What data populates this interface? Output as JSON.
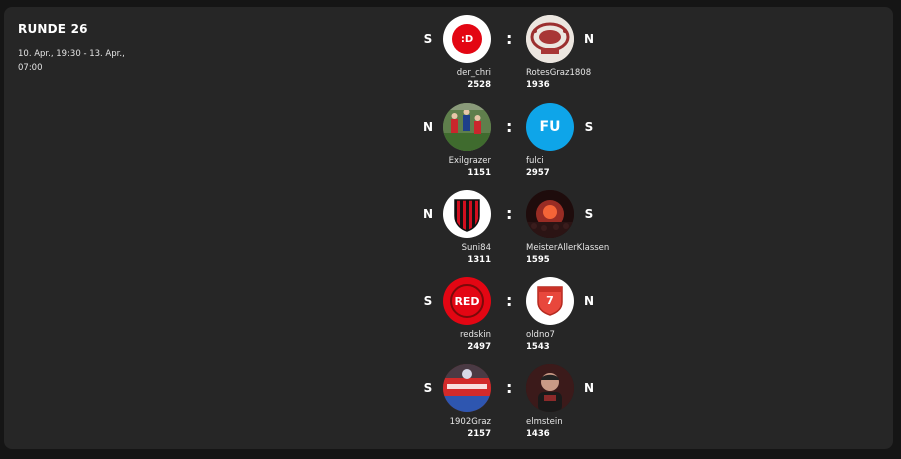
{
  "round": {
    "title": "RUNDE 26",
    "date": "10. Apr., 19:30 - 13. Apr., 07:00"
  },
  "separator": ":",
  "matches": [
    {
      "left": {
        "result": "S",
        "name": "der_chri",
        "score": "2528",
        "avatar": "red-emoticon-logo",
        "avatar_text": ":D"
      },
      "right": {
        "result": "N",
        "name": "RotesGraz1808",
        "score": "1936",
        "avatar": "club-crest-photo"
      }
    },
    {
      "left": {
        "result": "N",
        "name": "Exilgrazer",
        "score": "1151",
        "avatar": "football-players-photo"
      },
      "right": {
        "result": "S",
        "name": "fulci",
        "score": "2957",
        "avatar": "blue-initials-avatar",
        "avatar_text": "FU"
      }
    },
    {
      "left": {
        "result": "N",
        "name": "Suni84",
        "score": "1311",
        "avatar": "striped-shield-crest"
      },
      "right": {
        "result": "S",
        "name": "MeisterAllerKlassen",
        "score": "1595",
        "avatar": "flare-crowd-photo"
      }
    },
    {
      "left": {
        "result": "S",
        "name": "redskin",
        "score": "2497",
        "avatar": "red-circle-logo",
        "avatar_text": "RED"
      },
      "right": {
        "result": "N",
        "name": "oldno7",
        "score": "1543",
        "avatar": "number-seven-shield",
        "avatar_text": "7"
      }
    },
    {
      "left": {
        "result": "S",
        "name": "1902Graz",
        "score": "2157",
        "avatar": "fan-banner-photo"
      },
      "right": {
        "result": "N",
        "name": "elmstein",
        "score": "1436",
        "avatar": "person-photo"
      }
    }
  ],
  "colors": {
    "background": "#151515",
    "card": "#262626",
    "red": "#e30613",
    "blue": "#0ea5e9"
  }
}
